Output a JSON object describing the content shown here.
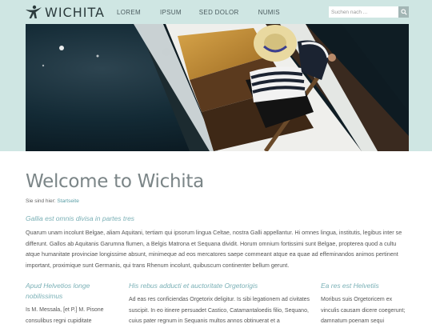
{
  "header": {
    "logo_text": "WICHITA",
    "nav": [
      "LOREM",
      "IPSUM",
      "SED DOLOR",
      "NUMIS"
    ],
    "search_placeholder": "Suchen nach ..."
  },
  "main": {
    "title": "Welcome to Wichita",
    "breadcrumb_prefix": "Sie sind hier:",
    "breadcrumb_link": "Startseite",
    "subheading": "Gallia est omnis divisa in partes tres",
    "paragraph": "Quarum unam incolunt Belgae, aliam Aquitani, tertiam qui ipsorum lingua Celtae, nostra Galli appellantur. Hi omnes lingua, institutis, legibus inter se differunt. Gallos ab Aquitanis Garumna flumen, a Belgis Matrona et Sequana dividit. Horum omnium fortissimi sunt Belgae, propterea quod a cultu atque humanitate provinciae longissime absunt, minimeque ad eos mercatores saepe commeant atque ea quae ad effeminandos animos pertinent important, proximique sunt Germanis, qui trans Rhenum incolunt, quibuscum continenter bellum gerunt."
  },
  "columns": [
    {
      "heading": "Apud Helvetios longe nobilissimus",
      "text": "Is M. Messala, [et P.] M. Pisone consulibus regni cupiditate"
    },
    {
      "heading": "His rebus adducti et auctoritate Orgetorigis",
      "text": "Ad eas res conficiendas Orgetorix deligitur. Is sibi legationem ad civitates suscipit. In eo itinere persuadet Castico, Catamantaloedis filio, Sequano, cuius pater regnum in Sequanis multos annos obtinuerat et a"
    },
    {
      "heading": "Ea res est Helvetiis",
      "text": "Moribus suis Orgetoricem ex vinculis causam dicere coegerunt; damnatum poenam sequi"
    }
  ],
  "colors": {
    "band": "#cfe6e3",
    "accent": "#7ab0b6",
    "link": "#5a9ea6",
    "title": "#7b8587"
  },
  "icons": {
    "logo": "person-leaping-icon",
    "search": "magnifier-icon"
  }
}
